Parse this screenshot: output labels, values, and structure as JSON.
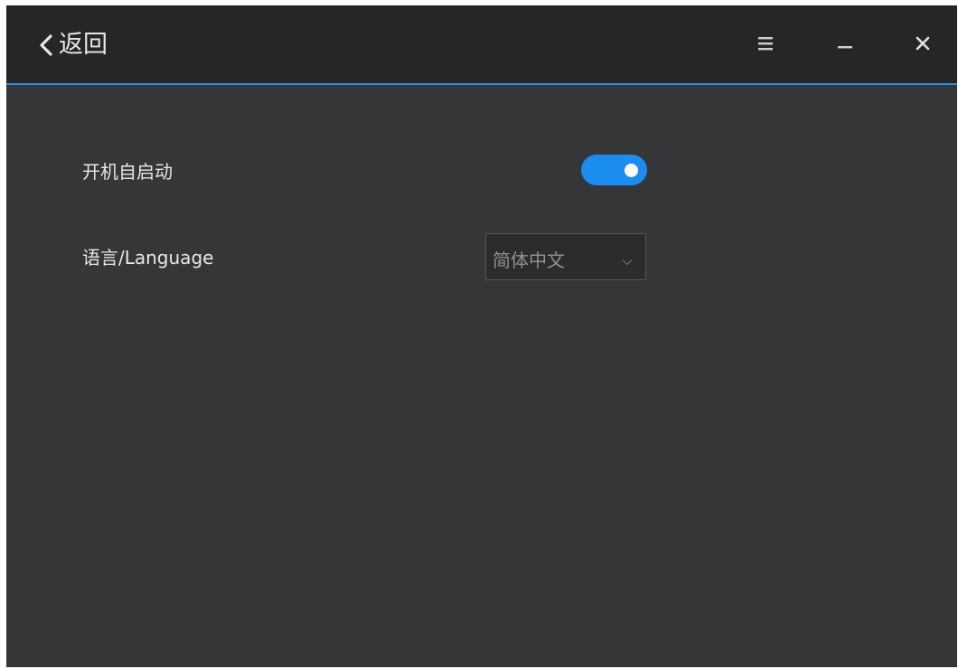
{
  "titlebar": {
    "back_label": "返回",
    "back_icon": "chevron-left-icon",
    "menu_icon": "hamburger-menu-icon",
    "minimize_icon": "minimize-icon",
    "close_icon": "close-icon",
    "accent_color": "#2f88e3"
  },
  "settings": {
    "autostart": {
      "label": "开机自启动",
      "enabled": true,
      "toggle_color": "#1b8cf0"
    },
    "language": {
      "label": "语言/Language",
      "selected": "简体中文",
      "dropdown_icon": "chevron-down-icon"
    }
  }
}
